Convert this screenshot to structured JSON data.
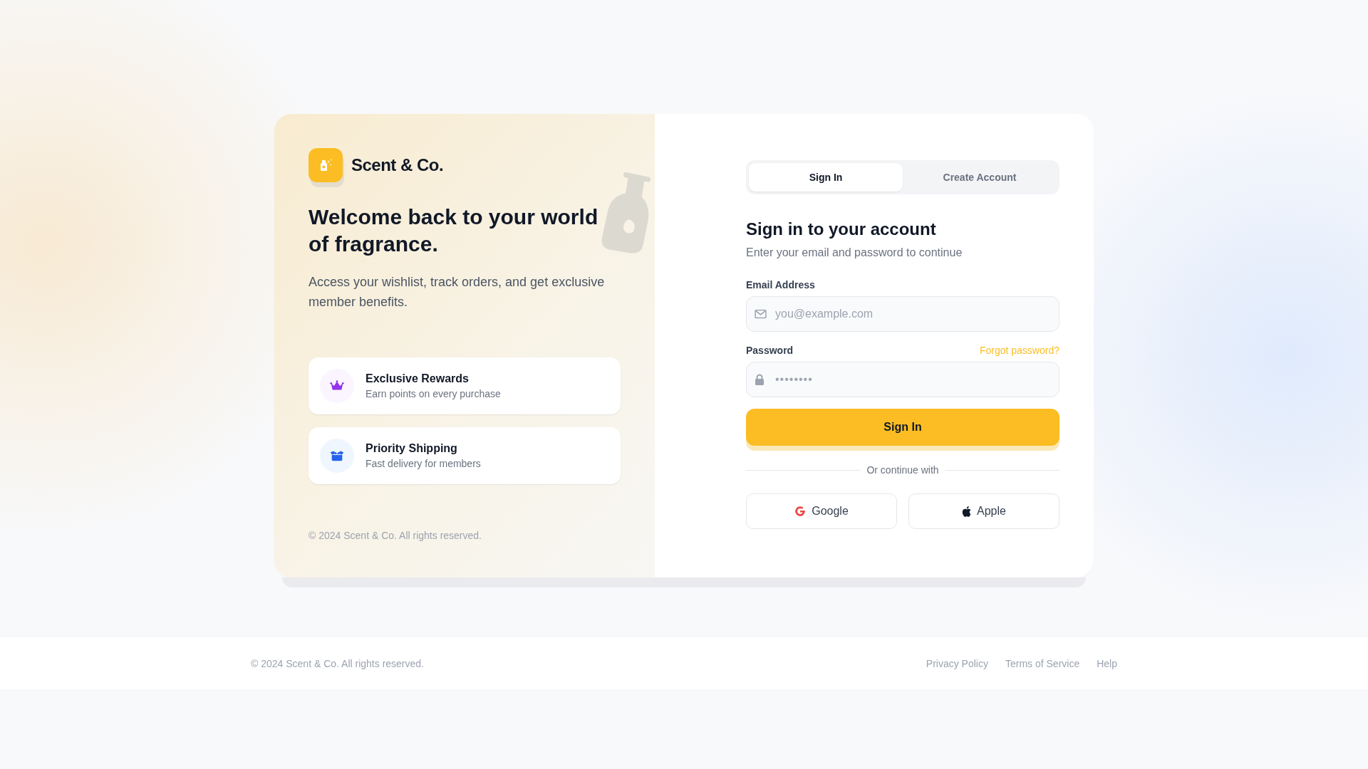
{
  "brand": {
    "name": "Scent & Co."
  },
  "hero": {
    "title": "Welcome back to your world of fragrance.",
    "subtitle": "Access your wishlist, track orders, and get exclusive member benefits."
  },
  "features": [
    {
      "kind": "rewards",
      "title": "Exclusive Rewards",
      "description": "Earn points on every purchase"
    },
    {
      "kind": "shipping",
      "title": "Priority Shipping",
      "description": "Fast delivery for members"
    }
  ],
  "panel_copyright": "© 2024 Scent & Co. All rights reserved.",
  "tabs": [
    {
      "label": "Sign In",
      "selected": true
    },
    {
      "label": "Create Account",
      "selected": false
    }
  ],
  "form": {
    "title": "Sign in to your account",
    "subtitle": "Enter your email and password to continue",
    "email": {
      "label": "Email Address",
      "placeholder": "you@example.com"
    },
    "password": {
      "label": "Password",
      "value": "••••••••",
      "forgot_link": "Forgot password?"
    },
    "submit": "Sign In",
    "divider": "Or continue with",
    "social": [
      {
        "kind": "google",
        "label": "Google"
      },
      {
        "kind": "apple",
        "label": "Apple"
      }
    ]
  },
  "footer": {
    "copyright": "© 2024 Scent & Co. All rights reserved.",
    "links": [
      "Privacy Policy",
      "Terms of Service",
      "Help"
    ]
  }
}
